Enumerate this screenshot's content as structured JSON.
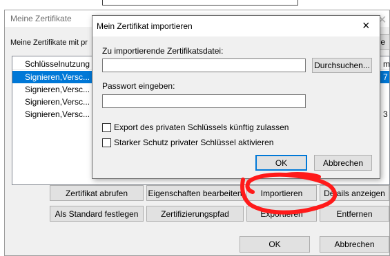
{
  "back_window": {
    "title": "Meine Zertifikate",
    "subtitle_fragment": "Meine Zertifikate mit pr",
    "right_fragment": "e",
    "column_header": "Schlüsselnutzung",
    "column_header_right": "m",
    "rows": [
      {
        "text": "Signieren,Versc...",
        "tail": "7",
        "selected": true
      },
      {
        "text": "Signieren,Versc...",
        "tail": "",
        "selected": false
      },
      {
        "text": "Signieren,Versc...",
        "tail": "",
        "selected": false
      },
      {
        "text": "Signieren,Versc...",
        "tail": "3",
        "selected": false
      }
    ],
    "buttons": {
      "zertifikat_abrufen": "Zertifikat abrufen",
      "eigenschaften_bearbeiten": "Eigenschaften bearbeiten",
      "importieren": "Importieren",
      "details_anzeigen": "Details anzeigen",
      "als_standard": "Als Standard festlegen",
      "zertifizierungspfad": "Zertifizierungspfad",
      "exportieren": "Exportieren",
      "entfernen": "Entfernen",
      "ok": "OK",
      "abbrechen": "Abbrechen"
    }
  },
  "dialog": {
    "title": "Mein Zertifikat importieren",
    "close_glyph": "×",
    "file_label": "Zu importierende Zertifikatsdatei:",
    "file_value": "",
    "browse_button": "Durchsuchen...",
    "password_label": "Passwort eingeben:",
    "password_value": "",
    "checkbox_export": {
      "label": "Export des privaten Schlüssels künftig zulassen",
      "checked": false
    },
    "checkbox_strong": {
      "label": "Starker Schutz privater Schlüssel aktivieren",
      "checked": false
    },
    "ok_button": "OK",
    "cancel_button": "Abbrechen"
  },
  "colors": {
    "selection": "#0078d7",
    "annotation": "#ff1a1a",
    "dialog_bg": "#f0f0f0",
    "button_bg": "#e1e1e1"
  }
}
